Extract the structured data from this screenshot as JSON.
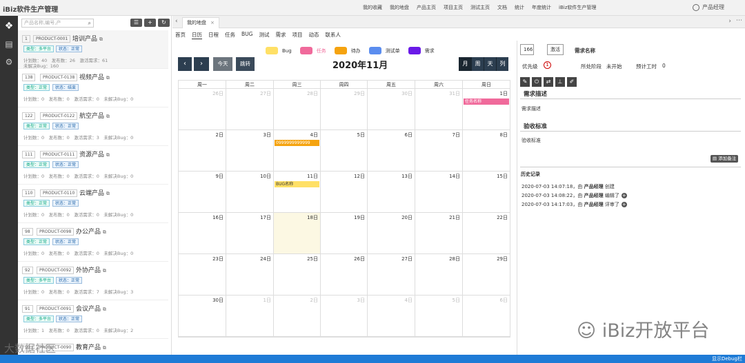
{
  "app": {
    "title": "iBiz软件生产管理"
  },
  "topnav": [
    "我的收藏",
    "我的地盘",
    "产品主页",
    "项目主页",
    "测试主页",
    "文档",
    "统计",
    "年度统计",
    "iBiz软件生产管理"
  ],
  "user": {
    "name": "产品经理"
  },
  "sidebar": {
    "search_placeholder": "产品名称,编号,产",
    "tool_icons": [
      "list-icon",
      "plus-icon",
      "refresh-icon"
    ],
    "products": [
      {
        "num": "1",
        "code": "PRODUCT-0001",
        "name": "培训产品",
        "type": "类型：多平台",
        "status": "状态：正常",
        "stats": "计划数：40　发布数：26　激活需求：61",
        "stats2": "未解决Bug：160"
      },
      {
        "num": "138",
        "code": "PRODUCT-0138",
        "name": "视频产品",
        "type": "类型：正常",
        "status": "状态：结束",
        "stats": "计划数：0　发布数：0　激活需求：0　未解决Bug：0"
      },
      {
        "num": "122",
        "code": "PRODUCT-0122",
        "name": "航空产品",
        "type": "类型：正常",
        "status": "状态：正常",
        "stats": "计划数：0　发布数：0　激活需求：3　未解决Bug：0"
      },
      {
        "num": "111",
        "code": "PRODUCT-0111",
        "name": "资源产品",
        "type": "类型：正常",
        "status": "状态：正常",
        "stats": "计划数：0　发布数：0　激活需求：0　未解决Bug：0"
      },
      {
        "num": "110",
        "code": "PRODUCT-0110",
        "name": "云端产品",
        "type": "类型：正常",
        "status": "状态：正常",
        "stats": "计划数：0　发布数：0　激活需求：0　未解决Bug：0"
      },
      {
        "num": "98",
        "code": "PRODUCT-0098",
        "name": "办公产品",
        "type": "类型：正常",
        "status": "状态：正常",
        "stats": "计划数：0　发布数：0　激活需求：0　未解决Bug：0"
      },
      {
        "num": "92",
        "code": "PRODUCT-0092",
        "name": "外协产品",
        "type": "类型：多平台",
        "status": "状态：正常",
        "stats": "计划数：0　发布数：0　激活需求：7　未解决Bug：3"
      },
      {
        "num": "91",
        "code": "PRODUCT-0091",
        "name": "会议产品",
        "type": "类型：多平台",
        "status": "状态：正常",
        "stats": "计划数：1　发布数：0　激活需求：0　未解决Bug：2"
      },
      {
        "num": "90",
        "code": "PRODUCT-0090",
        "name": "教育产品",
        "type": "",
        "status": "",
        "stats": ""
      }
    ]
  },
  "tabbar": {
    "tab": "我的地盘"
  },
  "subnav": [
    "首页",
    "日历",
    "日程",
    "任务",
    "BUG",
    "测试",
    "需求",
    "项目",
    "动态",
    "联系人"
  ],
  "legend": [
    {
      "label": "Bug",
      "color": "#ffe066"
    },
    {
      "label": "任务",
      "color": "#f06a9b"
    },
    {
      "label": "待办",
      "color": "#f5a30f"
    },
    {
      "label": "测试单",
      "color": "#5b8def"
    },
    {
      "label": "需求",
      "color": "#6a1ae8"
    }
  ],
  "calendar": {
    "title": "2020年11月",
    "today_btn": "今天",
    "jump_btn": "跳转",
    "views": [
      "月",
      "周",
      "天",
      "列"
    ],
    "weekdays": [
      "周一",
      "周二",
      "周三",
      "周四",
      "周五",
      "周六",
      "周日"
    ],
    "days": [
      "26日",
      "27日",
      "28日",
      "29日",
      "30日",
      "31日",
      "1日",
      "2日",
      "3日",
      "4日",
      "5日",
      "6日",
      "7日",
      "8日",
      "9日",
      "10日",
      "11日",
      "12日",
      "13日",
      "14日",
      "15日",
      "16日",
      "17日",
      "18日",
      "19日",
      "20日",
      "21日",
      "22日",
      "23日",
      "24日",
      "25日",
      "26日",
      "27日",
      "28日",
      "29日",
      "30日",
      "1日",
      "2日",
      "3日",
      "4日",
      "5日",
      "6日"
    ],
    "events": [
      {
        "cell": 6,
        "text": "任务名称",
        "color": "#f06a9b"
      },
      {
        "cell": 9,
        "text": "0999999999999",
        "color": "#f5a30f"
      },
      {
        "cell": 16,
        "text": "BUG名称",
        "color": "#ffe066",
        "fg": "#333"
      }
    ]
  },
  "detail": {
    "id": "166",
    "state_btn": "激活",
    "name": "需求名称",
    "priority_label": "优先级",
    "priority": "1",
    "stage_label": "所处阶段",
    "stage": "未开始",
    "hours_label": "预计工时",
    "hours": "0",
    "action_icons": [
      "edit-icon",
      "power-icon",
      "swap-icon",
      "hierarchy-icon",
      "pencil-icon"
    ],
    "desc_title": "需求描述",
    "desc_text": "需求描述",
    "accept_title": "验收标准",
    "accept_text": "验收标准",
    "add_note": "添加备注",
    "history_title": "历史记录",
    "history": [
      {
        "time": "2020-07-03 14:07:18，由",
        "who": "产品经理",
        "action": "创建"
      },
      {
        "time": "2020-07-03 14:08:22，由",
        "who": "产品经理",
        "action": "编辑了"
      },
      {
        "time": "2020-07-03 14:17:03，由",
        "who": "产品经理",
        "action": "评审了"
      }
    ]
  },
  "watermark": "iBiz开放平台",
  "watermark_left": "大数据社区",
  "footer": {
    "debug": "显示Debug栏"
  }
}
